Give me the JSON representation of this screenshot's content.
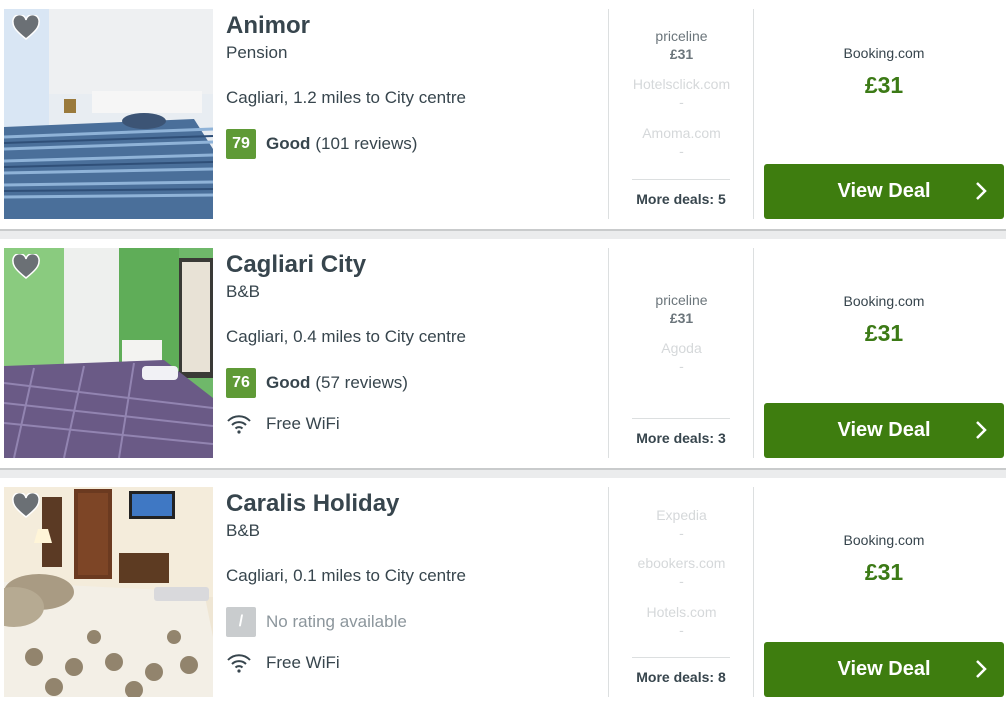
{
  "hotels": [
    {
      "name": "Animor",
      "type": "Pension",
      "location": "Cagliari, 1.2 miles to City centre",
      "rating": {
        "score": "79",
        "label": "Good",
        "reviews": "(101 reviews)"
      },
      "amenity": "",
      "deals": [
        {
          "provider": "priceline",
          "price": "£31",
          "active": true
        },
        {
          "provider": "Hotelsclick.com",
          "price": "-",
          "active": false
        },
        {
          "provider": "Amoma.com",
          "price": "-",
          "active": false
        }
      ],
      "more_deals": "More deals: 5",
      "main_provider": "Booking.com",
      "main_price": "£31",
      "button": "View Deal"
    },
    {
      "name": "Cagliari City",
      "type": "B&B",
      "location": "Cagliari, 0.4 miles to City centre",
      "rating": {
        "score": "76",
        "label": "Good",
        "reviews": "(57 reviews)"
      },
      "amenity": "Free WiFi",
      "deals": [
        {
          "provider": "priceline",
          "price": "£31",
          "active": true
        },
        {
          "provider": "Agoda",
          "price": "-",
          "active": false
        }
      ],
      "more_deals": "More deals: 3",
      "main_provider": "Booking.com",
      "main_price": "£31",
      "button": "View Deal"
    },
    {
      "name": "Caralis Holiday",
      "type": "B&B",
      "location": "Cagliari, 0.1 miles to City centre",
      "rating": {
        "score": "/",
        "label": "",
        "reviews": "",
        "none_text": "No rating available"
      },
      "amenity": "Free WiFi",
      "deals": [
        {
          "provider": "Expedia",
          "price": "-",
          "active": false
        },
        {
          "provider": "ebookers.com",
          "price": "-",
          "active": false
        },
        {
          "provider": "Hotels.com",
          "price": "-",
          "active": false
        }
      ],
      "more_deals": "More deals: 8",
      "main_provider": "Booking.com",
      "main_price": "£31",
      "button": "View Deal"
    }
  ],
  "icons": {
    "favorite": "heart-icon",
    "wifi": "wifi-icon",
    "button_arrow": "chevron-right-icon"
  },
  "colors": {
    "accent_green": "#3e7d0f",
    "price_green": "#3c7a16",
    "score_green": "#5f9a36"
  }
}
